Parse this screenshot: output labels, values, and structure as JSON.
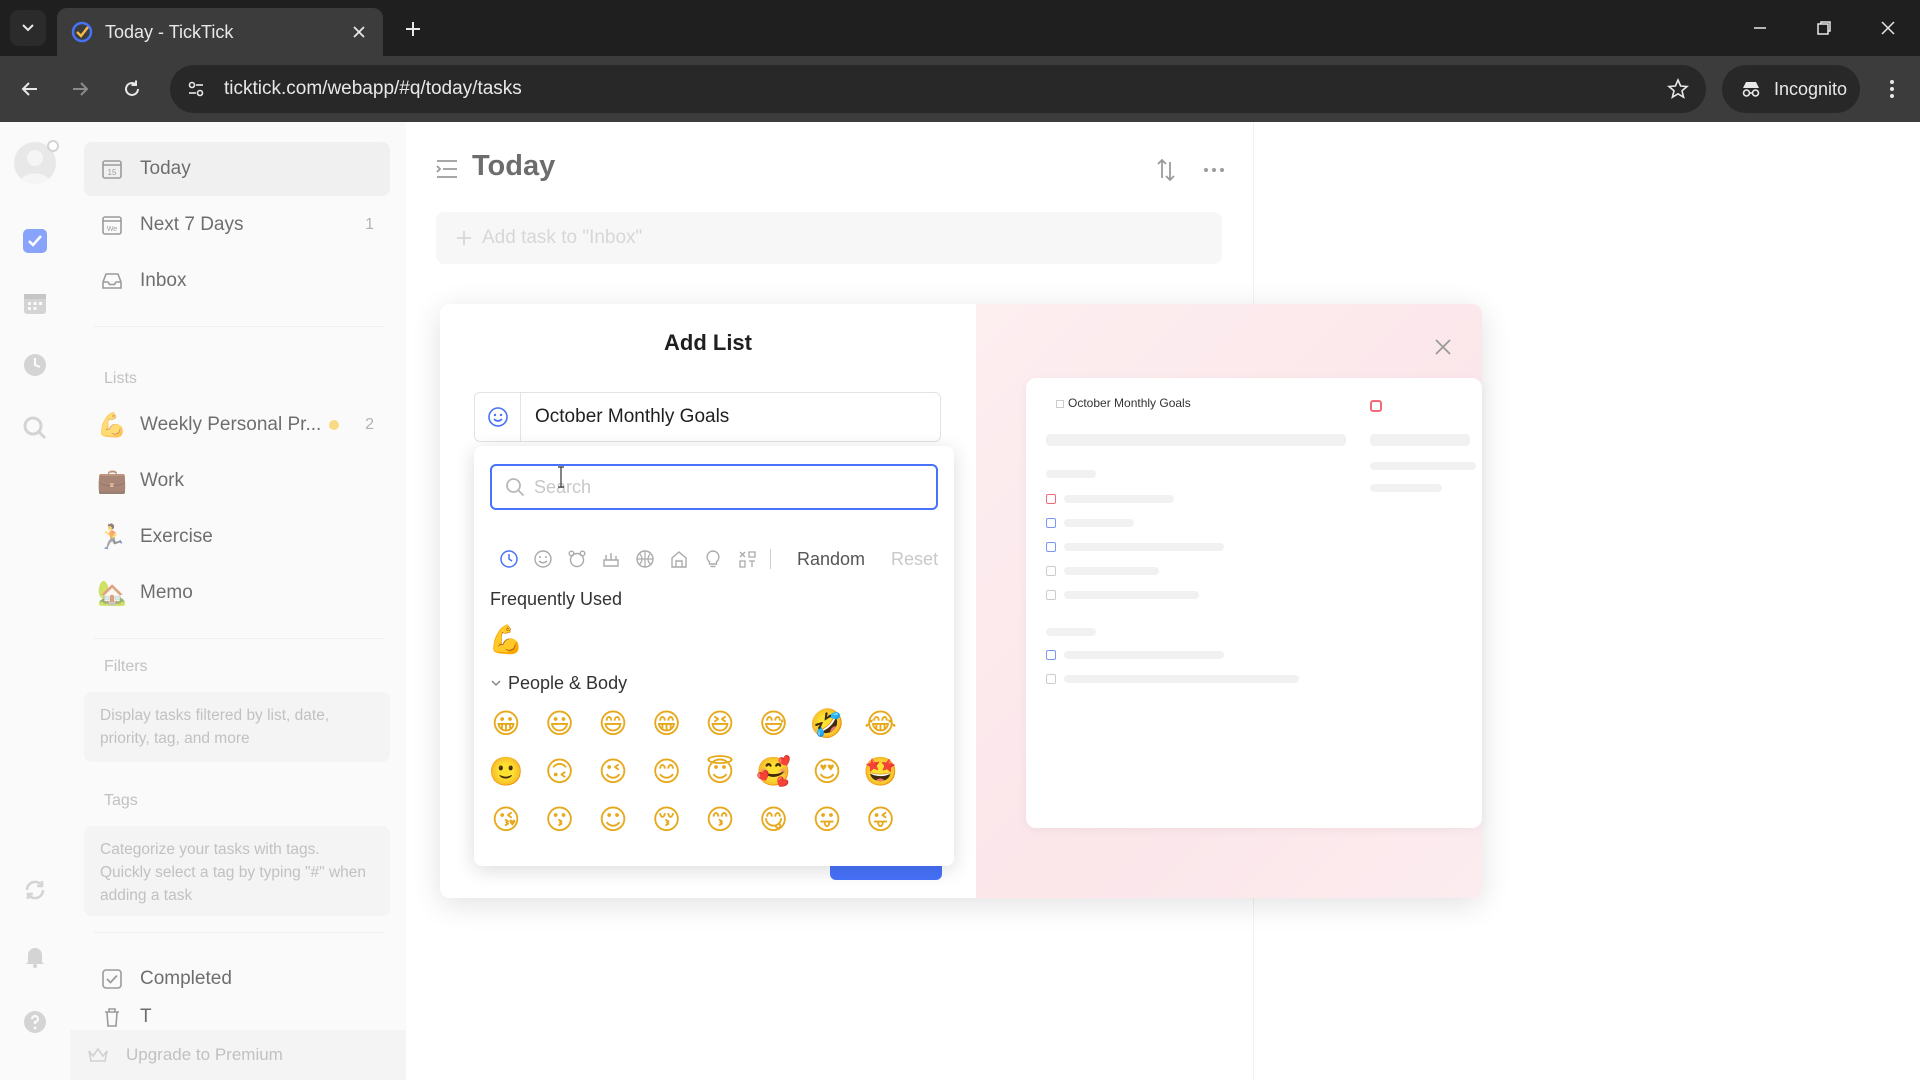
{
  "browser": {
    "tab_title": "Today - TickTick",
    "url": "ticktick.com/webapp/#q/today/tasks",
    "incognito_label": "Incognito"
  },
  "sidebar": {
    "smart_lists": [
      {
        "label": "Today",
        "icon": "calendar-15-icon",
        "count": ""
      },
      {
        "label": "Next 7 Days",
        "icon": "calendar-week-icon",
        "count": "1"
      },
      {
        "label": "Inbox",
        "icon": "inbox-icon",
        "count": ""
      }
    ],
    "lists_title": "Lists",
    "lists": [
      {
        "label": "Weekly Personal Pr...",
        "emoji": "💪",
        "count": "2"
      },
      {
        "label": "Work",
        "emoji": "💼",
        "count": ""
      },
      {
        "label": "Exercise",
        "emoji": "🏃",
        "count": ""
      },
      {
        "label": "Memo",
        "emoji": "🏡",
        "count": ""
      }
    ],
    "filters_title": "Filters",
    "filters_hint": "Display tasks filtered by list, date, priority, tag, and more",
    "tags_title": "Tags",
    "tags_hint": "Categorize your tasks with tags. Quickly select a tag by typing \"#\" when adding a task",
    "completed_label": "Completed",
    "trash_label": "T",
    "premium_label": "Upgrade to Premium"
  },
  "main": {
    "title": "Today",
    "add_task_placeholder": "Add task to \"Inbox\""
  },
  "dialog": {
    "title": "Add List",
    "list_name": "October Monthly Goals",
    "preview_title": "October Monthly Goals"
  },
  "emoji_picker": {
    "search_placeholder": "Search",
    "random_label": "Random",
    "reset_label": "Reset",
    "categories": [
      "recent-clock-icon",
      "smiley-icon",
      "animal-icon",
      "food-icon",
      "activity-ball-icon",
      "travel-building-icon",
      "object-bulb-icon",
      "symbol-icon"
    ],
    "frequently_used_title": "Frequently Used",
    "frequently_used": [
      "💪"
    ],
    "people_title": "People & Body",
    "people_emojis": [
      "😀",
      "😃",
      "😄",
      "😁",
      "😆",
      "😅",
      "🤣",
      "😂",
      "🙂",
      "🙃",
      "😉",
      "😊",
      "😇",
      "🥰",
      "😍",
      "🤩",
      "😘",
      "😗",
      "☺",
      "😚",
      "😙",
      "😋",
      "😛",
      "😜"
    ]
  },
  "colors": {
    "accent": "#4772fa",
    "tab_bg": "#3c3c3c",
    "sidebar_bg": "#f7f7f7",
    "preview_pink": "#fbe6ea"
  }
}
